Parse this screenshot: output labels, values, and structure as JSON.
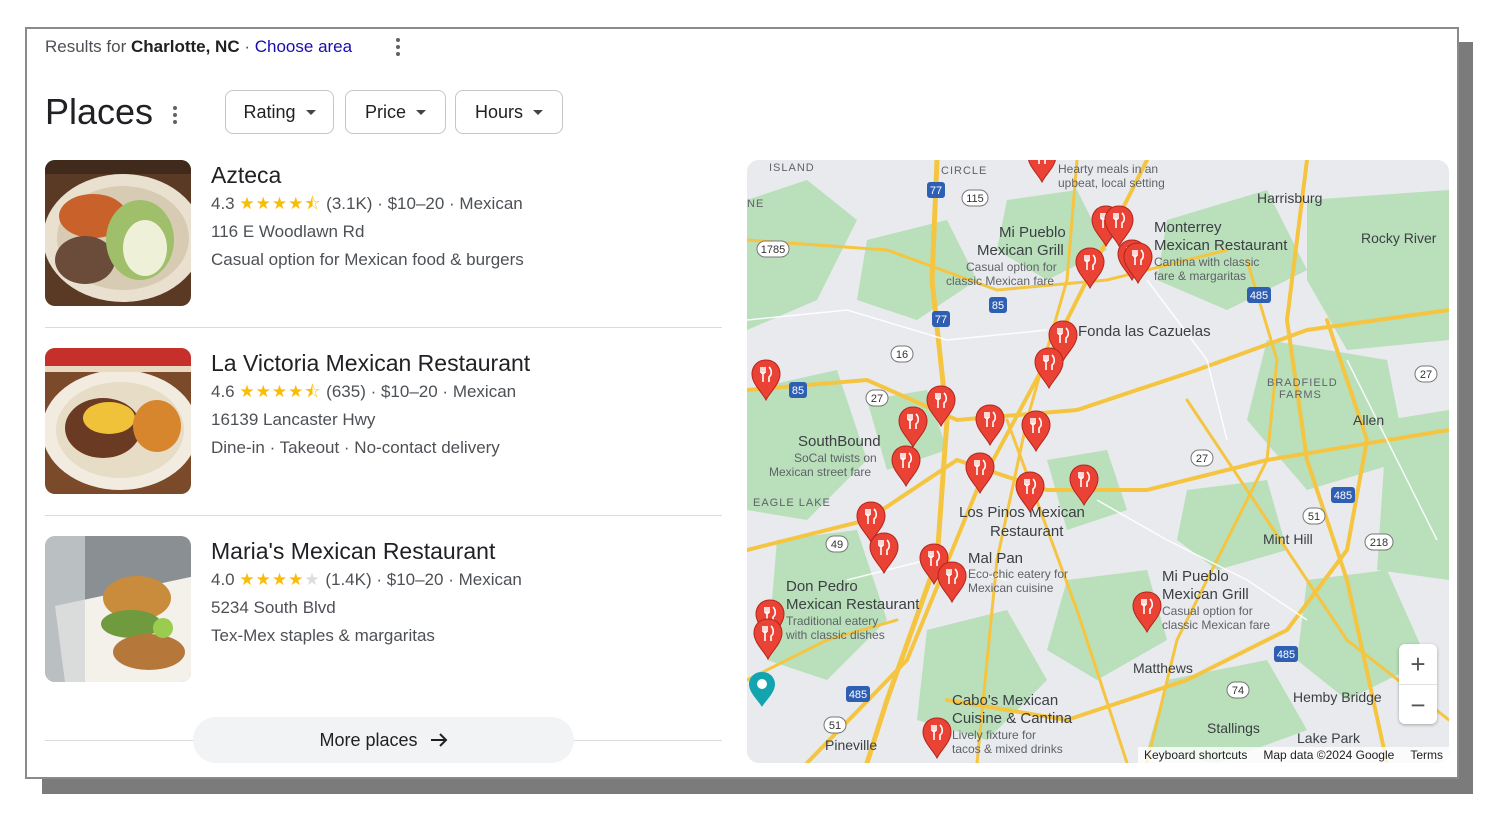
{
  "header": {
    "results_prefix": "Results for",
    "location": "Charlotte, NC",
    "separator": "·",
    "choose_area": "Choose area"
  },
  "places": {
    "title": "Places",
    "filters": [
      "Rating",
      "Price",
      "Hours"
    ]
  },
  "listings": [
    {
      "name": "Azteca",
      "rating": "4.3",
      "rating_value": 4.3,
      "stars": "★★★★⯪",
      "reviews": "(3.1K)",
      "price": "$10–20",
      "category": "Mexican",
      "address": "116 E Woodlawn Rd",
      "description": "Casual option for Mexican food & burgers"
    },
    {
      "name": "La Victoria Mexican Restaurant",
      "rating": "4.6",
      "rating_value": 4.6,
      "stars": "★★★★⯪",
      "reviews": "(635)",
      "price": "$10–20",
      "category": "Mexican",
      "address": "16139 Lancaster Hwy",
      "description": "Dine-in · Takeout · No-contact delivery"
    },
    {
      "name": "Maria's Mexican Restaurant",
      "rating": "4.0",
      "rating_value": 4.0,
      "stars": "★★★★",
      "stars_empty": "★",
      "reviews": "(1.4K)",
      "price": "$10–20",
      "category": "Mexican",
      "address": "5234 South Blvd",
      "description": "Tex-Mex staples & margaritas"
    }
  ],
  "more_places": "More places",
  "map": {
    "labels": {
      "island": "ISLAND",
      "circle": "CIRCLE",
      "harrisburg": "Harrisburg",
      "rocky_river": "Rocky River",
      "allen": "Allen",
      "bradfield": "BRADFIELD",
      "farms": "FARMS",
      "eagle_lake": "EAGLE LAKE",
      "mint_hill": "Mint Hill",
      "matthews": "Matthews",
      "hemby_bridge": "Hemby Bridge",
      "stallings": "Stallings",
      "lake_park": "Lake Park",
      "pineville": "Pineville",
      "ne": "NE"
    },
    "shields": [
      "77",
      "115",
      "1785",
      "77",
      "85",
      "16",
      "85",
      "27",
      "485",
      "27",
      "27",
      "485",
      "51",
      "218",
      "49",
      "485",
      "485",
      "74",
      "51"
    ],
    "places": [
      {
        "name": "Mi Pueblo",
        "name2": "Mexican Grill",
        "desc1": "Casual option for",
        "desc2": "classic Mexican fare"
      },
      {
        "name": "Monterrey",
        "name2": "Mexican Restaurant",
        "desc1": "Cantina with classic",
        "desc2": "fare & margaritas"
      },
      {
        "name": "Fonda las Cazuelas"
      },
      {
        "name": "SouthBound",
        "desc1": "SoCal twists on",
        "desc2": "Mexican street fare"
      },
      {
        "name": "Los Pinos Mexican",
        "name2": "Restaurant"
      },
      {
        "name": "Mal Pan",
        "desc1": "Eco-chic eatery for",
        "desc2": "Mexican cuisine"
      },
      {
        "name": "Don Pedro",
        "name2": "Mexican Restaurant",
        "desc1": "Traditional eatery",
        "desc2": "with classic dishes"
      },
      {
        "name": "Mi Pueblo",
        "name2": "Mexican Grill",
        "desc1": "Casual option for",
        "desc2": "classic Mexican fare"
      },
      {
        "name": "Cabo's Mexican",
        "name2": "Cuisine & Cantina",
        "desc1": "Lively fixture for",
        "desc2": "tacos & mixed drinks"
      },
      {
        "name": "Hearty meals in an",
        "name2": "upbeat, local setting"
      }
    ],
    "zoom_in": "+",
    "zoom_out": "−",
    "attribution": {
      "shortcuts": "Keyboard shortcuts",
      "data": "Map data ©2024 Google",
      "terms": "Terms"
    },
    "colors": {
      "land": "#e8eaed",
      "park": "#b9dfbb",
      "road": "#f5c542",
      "pin": "#ea4335"
    }
  }
}
